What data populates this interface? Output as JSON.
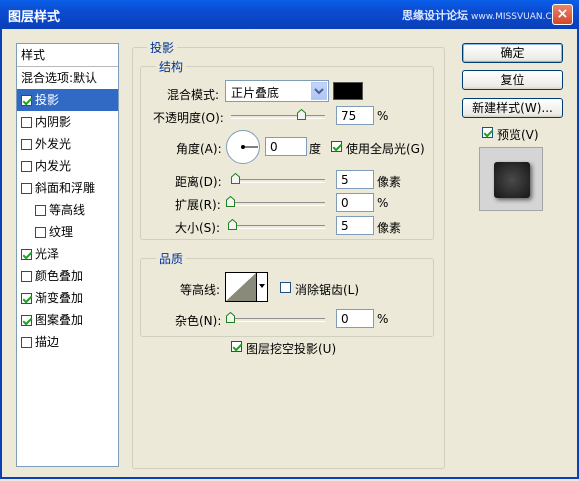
{
  "window": {
    "title": "图层样式",
    "watermark_cn": "思缘设计论坛",
    "watermark_en": "www.MISSVUAN.COM",
    "close_glyph": "×"
  },
  "style_list": {
    "header": "样式",
    "items": [
      {
        "label": "混合选项:默认",
        "checkbox": false,
        "checked": false,
        "selected": false,
        "sub": false
      },
      {
        "label": "投影",
        "checkbox": true,
        "checked": true,
        "selected": true,
        "sub": false
      },
      {
        "label": "内阴影",
        "checkbox": true,
        "checked": false,
        "selected": false,
        "sub": false
      },
      {
        "label": "外发光",
        "checkbox": true,
        "checked": false,
        "selected": false,
        "sub": false
      },
      {
        "label": "内发光",
        "checkbox": true,
        "checked": false,
        "selected": false,
        "sub": false
      },
      {
        "label": "斜面和浮雕",
        "checkbox": true,
        "checked": false,
        "selected": false,
        "sub": false
      },
      {
        "label": "等高线",
        "checkbox": true,
        "checked": false,
        "selected": false,
        "sub": true
      },
      {
        "label": "纹理",
        "checkbox": true,
        "checked": false,
        "selected": false,
        "sub": true
      },
      {
        "label": "光泽",
        "checkbox": true,
        "checked": true,
        "selected": false,
        "sub": false
      },
      {
        "label": "颜色叠加",
        "checkbox": true,
        "checked": false,
        "selected": false,
        "sub": false
      },
      {
        "label": "渐变叠加",
        "checkbox": true,
        "checked": true,
        "selected": false,
        "sub": false
      },
      {
        "label": "图案叠加",
        "checkbox": true,
        "checked": true,
        "selected": false,
        "sub": false
      },
      {
        "label": "描边",
        "checkbox": true,
        "checked": false,
        "selected": false,
        "sub": false
      }
    ]
  },
  "drop_shadow": {
    "section_title": "投影",
    "structure": {
      "title": "结构",
      "blend_mode_label": "混合模式:",
      "blend_mode_value": "正片叠底",
      "shadow_color": "#000000",
      "opacity_label": "不透明度(O):",
      "opacity_value": "75",
      "opacity_percent": 0.75,
      "opacity_unit": "%",
      "angle_label": "角度(A):",
      "angle_value": "0",
      "angle_unit": "度",
      "global_light_label": "使用全局光(G)",
      "global_light_checked": true,
      "distance_label": "距离(D):",
      "distance_value": "5",
      "distance_unit": "像素",
      "spread_label": "扩展(R):",
      "spread_value": "0",
      "spread_unit": "%",
      "size_label": "大小(S):",
      "size_value": "5",
      "size_unit": "像素"
    },
    "quality": {
      "title": "品质",
      "contour_label": "等高线:",
      "anti_alias_label": "消除锯齿(L)",
      "anti_alias_checked": false,
      "noise_label": "杂色(N):",
      "noise_value": "0",
      "noise_unit": "%"
    },
    "knockout_label": "图层挖空投影(U)",
    "knockout_checked": true
  },
  "buttons": {
    "ok": "确定",
    "reset": "复位",
    "new_style": "新建样式(W)...",
    "preview_label": "预览(V)",
    "preview_checked": true
  },
  "colors": {
    "titlebar": "#0A4BD0",
    "selection": "#316AC5",
    "dialog_bg": "#ECE9D8",
    "legend_text": "#003399"
  },
  "icons": {
    "dropdown": "chevron-down-icon",
    "angle_dial": "angle-dial-icon",
    "close": "close-icon"
  }
}
